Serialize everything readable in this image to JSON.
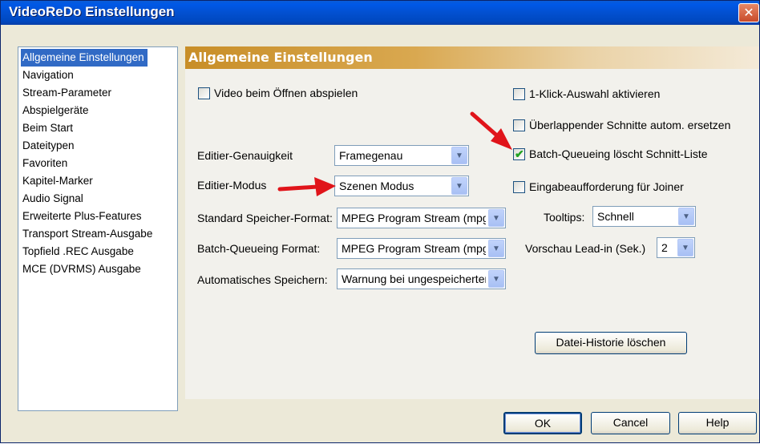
{
  "window": {
    "title": "VideoReDo Einstellungen",
    "close_glyph": "✕"
  },
  "nav": {
    "items": [
      "Allgemeine Einstellungen",
      "Navigation",
      "Stream-Parameter",
      "Abspielgeräte",
      "Beim Start",
      "Dateitypen",
      "Favoriten",
      "Kapitel-Marker",
      "Audio Signal",
      "Erweiterte Plus-Features",
      "Transport Stream-Ausgabe",
      "Topfield .REC Ausgabe",
      "MCE (DVRMS) Ausgabe"
    ],
    "selected_index": 0
  },
  "panel": {
    "header": "Allgemeine Einstellungen",
    "checkboxes": {
      "play_on_open": {
        "label": "Video beim Öffnen abspielen",
        "checked": false
      },
      "one_click": {
        "label": "1-Klick-Auswahl aktivieren",
        "checked": false
      },
      "overlap_replace": {
        "label": "Überlappender Schnitte autom. ersetzen",
        "checked": false
      },
      "batch_clear": {
        "label": "Batch-Queueing löscht Schnitt-Liste",
        "checked": true
      },
      "joiner_prompt": {
        "label": "Eingabeaufforderung für Joiner",
        "checked": false
      }
    },
    "fields": {
      "edit_precision": {
        "label": "Editier-Genauigkeit",
        "value": "Framegenau"
      },
      "edit_mode": {
        "label": "Editier-Modus",
        "value": "Szenen Modus"
      },
      "save_format": {
        "label": "Standard Speicher-Format:",
        "value": "MPEG Program Stream (mpg)"
      },
      "batch_format": {
        "label": "Batch-Queueing Format:",
        "value": "MPEG Program Stream (mpg)"
      },
      "autosave": {
        "label": "Automatisches Speichern:",
        "value": "Warnung bei ungespeicherten"
      },
      "tooltips": {
        "label": "Tooltips:",
        "value": "Schnell"
      },
      "preview_leadin": {
        "label": "Vorschau Lead-in (Sek.)",
        "value": "2"
      }
    },
    "check_glyph": "✔",
    "dropdown_glyph": "▼",
    "history_button": "Datei-Historie löschen"
  },
  "footer": {
    "ok": "OK",
    "cancel": "Cancel",
    "help": "Help"
  },
  "colors": {
    "arrow": "#e0141a",
    "title_bar": "#0054e3",
    "panel_header": "#d39b36",
    "selection": "#316ac5"
  }
}
